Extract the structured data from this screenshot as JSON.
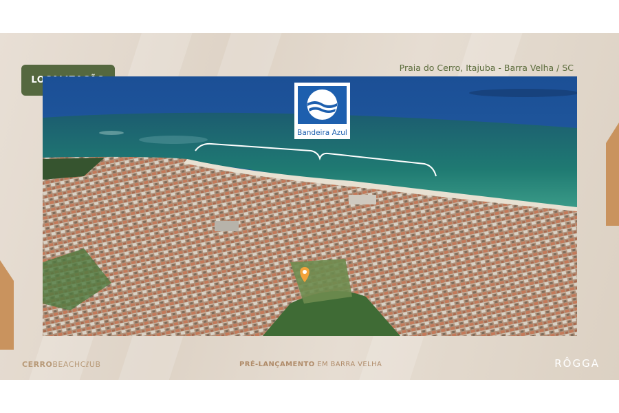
{
  "header": {
    "section_title": "LOCALIZAÇÃO",
    "location": "Praia do Cerro, Itajuba - Barra Velha / SC"
  },
  "map": {
    "flag_label": "Bandeira Azul",
    "marker_icon": "location-pin-icon"
  },
  "footer": {
    "brand_bold": "CERRO",
    "brand_rest": "BEACHCℓUB",
    "tagline_bold": "PRÉ-LANÇAMENTO",
    "tagline_rest": " EM BARRA VELHA",
    "logo": "RÔGGA"
  },
  "colors": {
    "badge": "#55683f",
    "location_text": "#5a6b3a",
    "accent": "#c9935e",
    "flag_blue": "#1d5fae"
  }
}
